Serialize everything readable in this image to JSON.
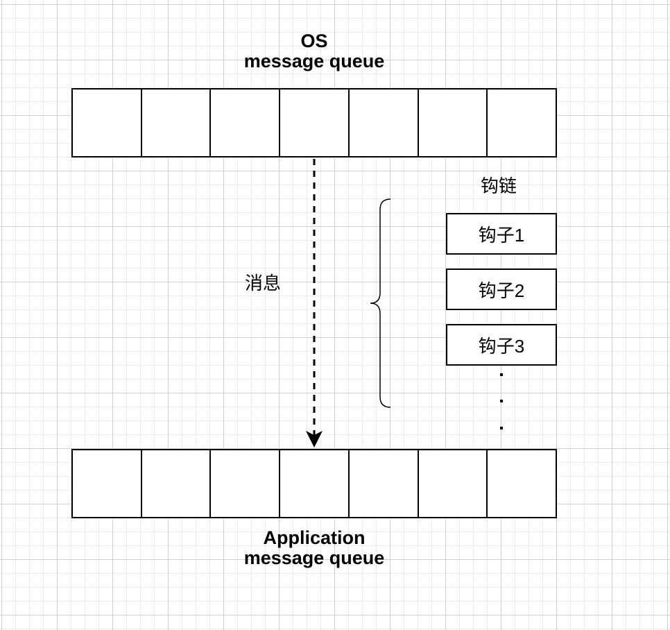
{
  "os_queue": {
    "title_line1": "OS",
    "title_line2": "message queue",
    "cell_count": 7
  },
  "app_queue": {
    "title_line1": "Application",
    "title_line2": "message queue",
    "cell_count": 7
  },
  "flow": {
    "label": "消息"
  },
  "hook_chain": {
    "label": "钩链",
    "hooks": [
      "钩子1",
      "钩子2",
      "钩子3"
    ],
    "continuation": "..."
  }
}
